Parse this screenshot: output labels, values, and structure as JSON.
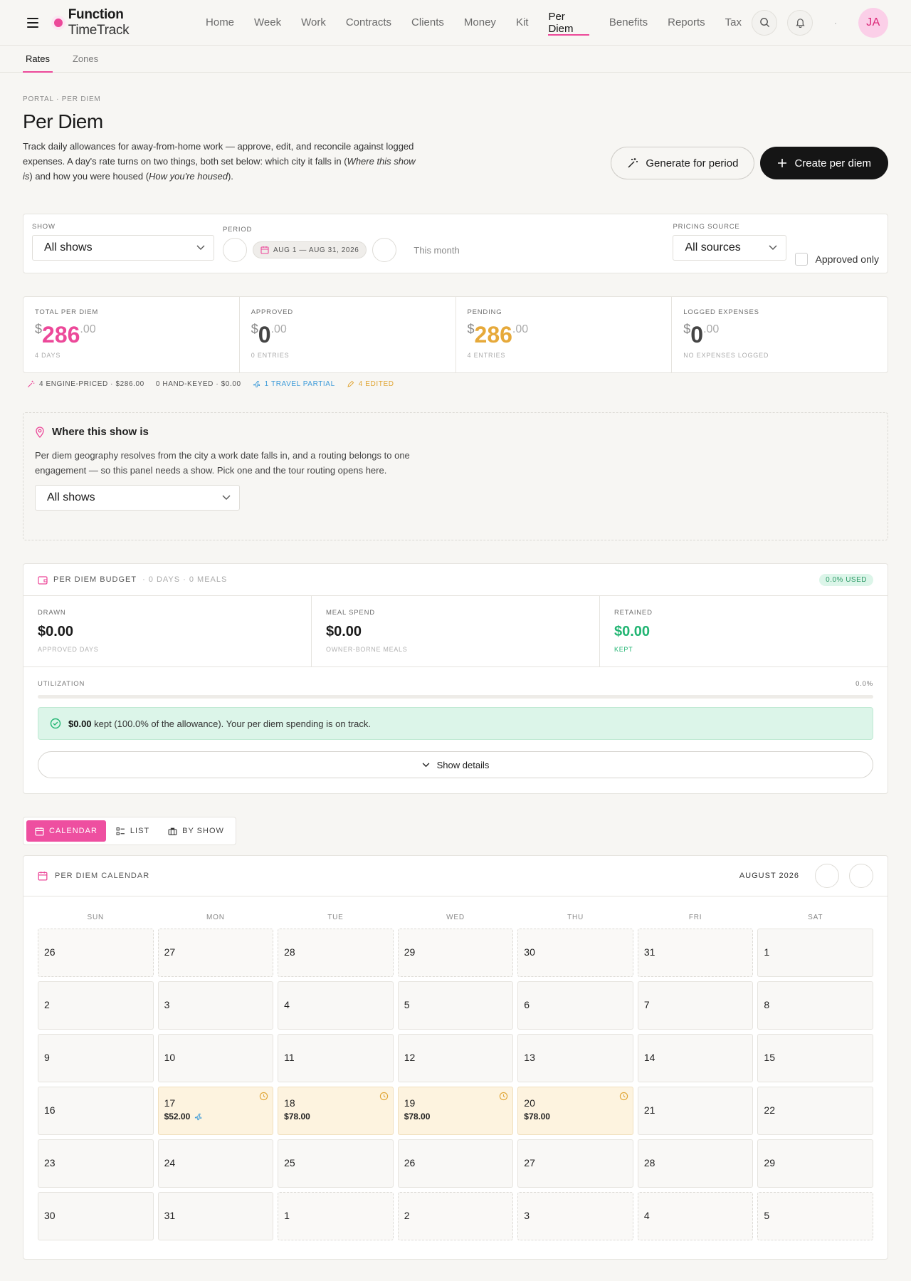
{
  "app": {
    "brand_bold": "Function",
    "brand_light": "TimeTrack",
    "avatar_initials": "JA",
    "colors": {
      "accent": "#ec4899",
      "success": "#22b573",
      "pending": "#e6a93a"
    }
  },
  "nav": {
    "items": [
      {
        "label": "Home",
        "active": false
      },
      {
        "label": "Week",
        "active": false
      },
      {
        "label": "Work",
        "active": false
      },
      {
        "label": "Contracts",
        "active": false
      },
      {
        "label": "Clients",
        "active": false
      },
      {
        "label": "Money",
        "active": false
      },
      {
        "label": "Kit",
        "active": false
      },
      {
        "label": "Per Diem",
        "active": true
      },
      {
        "label": "Benefits",
        "active": false
      },
      {
        "label": "Reports",
        "active": false
      },
      {
        "label": "Tax",
        "active": false
      }
    ],
    "icons": [
      "search-icon",
      "bell-icon"
    ]
  },
  "subtabs": [
    {
      "label": "Rates",
      "active": true
    },
    {
      "label": "Zones",
      "active": false
    }
  ],
  "page": {
    "breadcrumb": "PORTAL · PER DIEM",
    "title": "Per Diem",
    "desc_1": "Track daily allowances for away-from-home work — approve, edit, and reconcile against logged expenses. A day's rate turns on two things, both set below: which city it falls in (",
    "desc_i1": "Where this show is",
    "desc_2": ") and how you were housed (",
    "desc_i2": "How you're housed",
    "desc_3": ").",
    "btn_generate": "Generate for period",
    "btn_create": "Create per diem"
  },
  "filters": {
    "show_label": "SHOW",
    "show_value": "All shows",
    "period_label": "PERIOD",
    "period_value": "AUG 1 — AUG 31, 2026",
    "this_month": "This month",
    "source_label": "PRICING SOURCE",
    "source_value": "All sources",
    "approved_only": "Approved only"
  },
  "stats": [
    {
      "label": "TOTAL PER DIEM",
      "dollar": "$",
      "amount": "286",
      "cents": ".00",
      "sub": "4 DAYS",
      "tone": "pink"
    },
    {
      "label": "APPROVED",
      "dollar": "$",
      "amount": "0",
      "cents": ".00",
      "sub": "0 ENTRIES",
      "tone": "dark"
    },
    {
      "label": "PENDING",
      "dollar": "$",
      "amount": "286",
      "cents": ".00",
      "sub": "4 ENTRIES",
      "tone": "amber"
    },
    {
      "label": "LOGGED EXPENSES",
      "dollar": "$",
      "amount": "0",
      "cents": ".00",
      "sub": "NO EXPENSES LOGGED",
      "tone": "dark"
    }
  ],
  "stat_meta": {
    "engine": "4 ENGINE-PRICED · $286.00",
    "hand": "0 HAND-KEYED · $0.00",
    "travel": "1 TRAVEL PARTIAL",
    "edited": "4 EDITED"
  },
  "where": {
    "title": "Where this show is",
    "desc": "Per diem geography resolves from the city a work date falls in, and a routing belongs to one engagement — so this panel needs a show. Pick one and the tour routing opens here.",
    "select_value": "All shows"
  },
  "budget": {
    "title": "PER DIEM BUDGET",
    "meta": "· 0 DAYS · 0 MEALS",
    "used_badge": "0.0% USED",
    "drawn_label": "DRAWN",
    "drawn_value": "$0.00",
    "drawn_sub": "APPROVED DAYS",
    "meal_label": "MEAL SPEND",
    "meal_value": "$0.00",
    "meal_sub": "OWNER-BORNE MEALS",
    "retained_label": "RETAINED",
    "retained_value": "$0.00",
    "retained_sub": "KEPT",
    "util_label": "UTILIZATION",
    "util_value": "0.0%",
    "util_fraction": 0.0,
    "notice_bold": "$0.00",
    "notice_rest": " kept (100.0% of the allowance). Your per diem spending is on track.",
    "show_details": "Show details"
  },
  "views": [
    {
      "label": "CALENDAR",
      "active": true,
      "icon": "calendar-icon"
    },
    {
      "label": "LIST",
      "active": false,
      "icon": "list-icon"
    },
    {
      "label": "BY SHOW",
      "active": false,
      "icon": "briefcase-icon"
    }
  ],
  "calendar": {
    "title": "PER DIEM CALENDAR",
    "month": "AUGUST 2026",
    "dows": [
      "SUN",
      "MON",
      "TUE",
      "WED",
      "THU",
      "FRI",
      "SAT"
    ],
    "days": [
      {
        "n": "26",
        "out": true
      },
      {
        "n": "27",
        "out": true
      },
      {
        "n": "28",
        "out": true
      },
      {
        "n": "29",
        "out": true
      },
      {
        "n": "30",
        "out": true
      },
      {
        "n": "31",
        "out": true
      },
      {
        "n": "1",
        "out": false
      },
      {
        "n": "2"
      },
      {
        "n": "3"
      },
      {
        "n": "4"
      },
      {
        "n": "5"
      },
      {
        "n": "6"
      },
      {
        "n": "7"
      },
      {
        "n": "8"
      },
      {
        "n": "9"
      },
      {
        "n": "10"
      },
      {
        "n": "11"
      },
      {
        "n": "12"
      },
      {
        "n": "13"
      },
      {
        "n": "14"
      },
      {
        "n": "15"
      },
      {
        "n": "16"
      },
      {
        "n": "17",
        "amt": "$52.00",
        "travel": true
      },
      {
        "n": "18",
        "amt": "$78.00"
      },
      {
        "n": "19",
        "amt": "$78.00"
      },
      {
        "n": "20",
        "amt": "$78.00"
      },
      {
        "n": "21"
      },
      {
        "n": "22"
      },
      {
        "n": "23"
      },
      {
        "n": "24"
      },
      {
        "n": "25"
      },
      {
        "n": "26"
      },
      {
        "n": "27"
      },
      {
        "n": "28"
      },
      {
        "n": "29"
      },
      {
        "n": "30"
      },
      {
        "n": "31"
      },
      {
        "n": "1",
        "out": true
      },
      {
        "n": "2",
        "out": true
      },
      {
        "n": "3",
        "out": true
      },
      {
        "n": "4",
        "out": true
      },
      {
        "n": "5",
        "out": true
      }
    ]
  }
}
